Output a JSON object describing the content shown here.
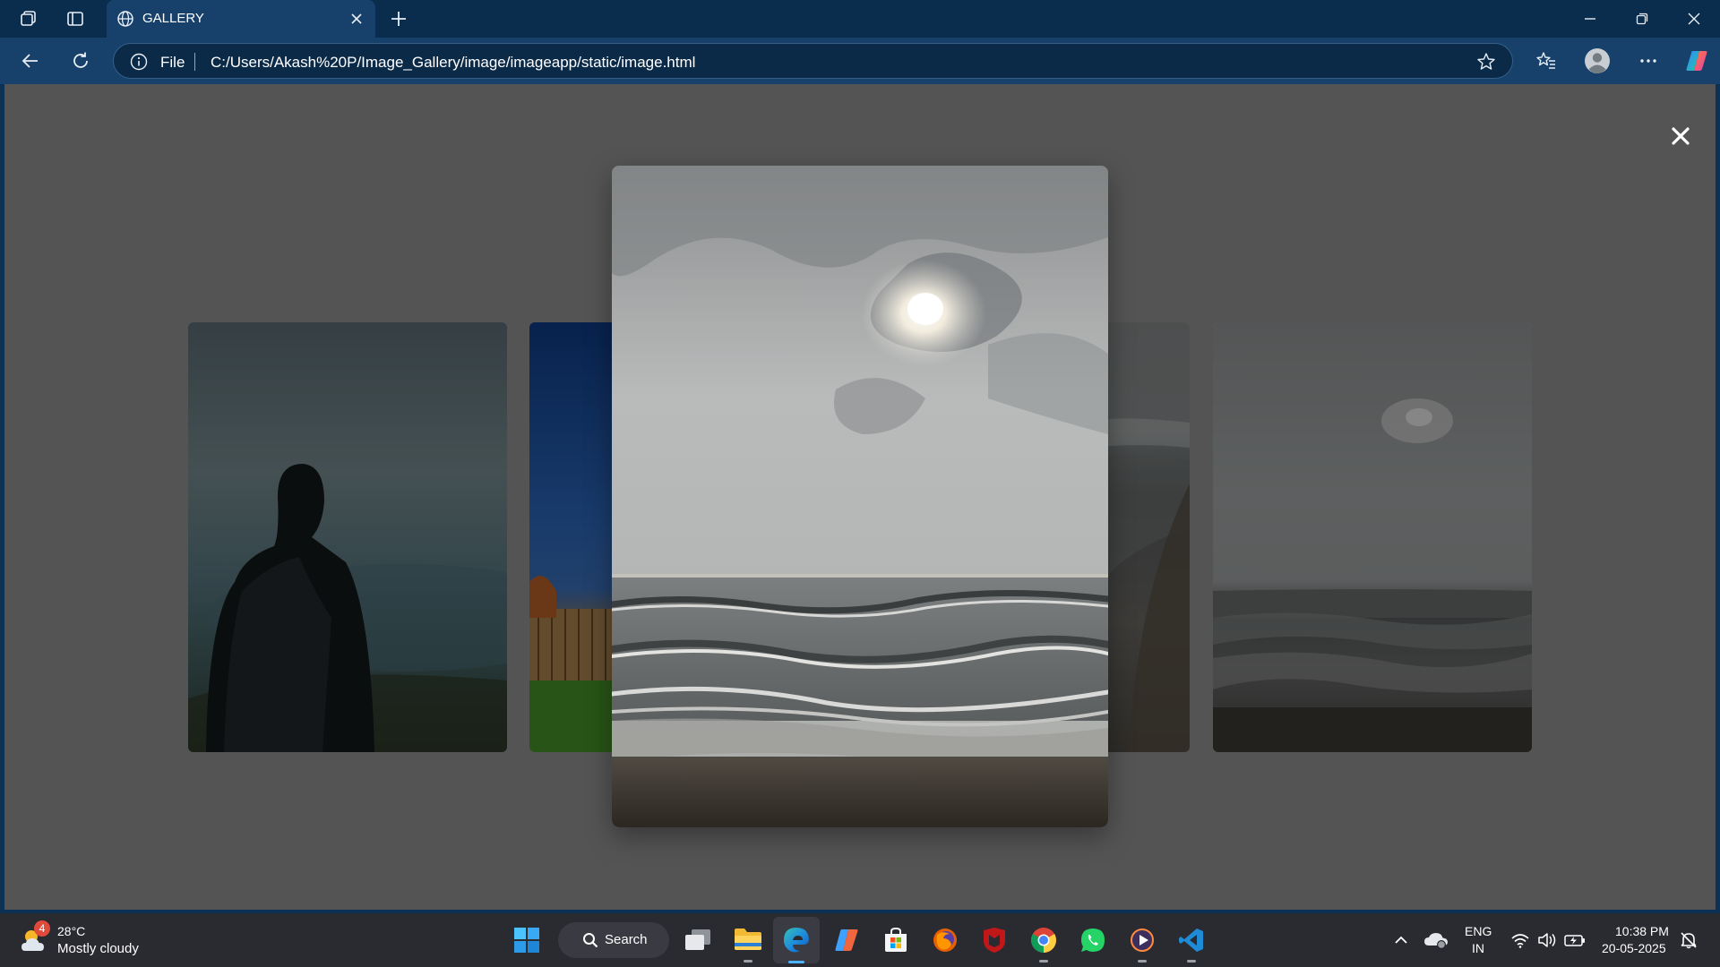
{
  "browser": {
    "tab": {
      "title": "GALLERY"
    },
    "address": {
      "scheme_label": "File",
      "url": "C:/Users/Akash%20P/Image_Gallery/image/imageapp/static/image.html"
    },
    "theme_colors": {
      "frame": "#0a2c4d",
      "toolbar": "#17416a",
      "accent": "#4ab3ff"
    },
    "icons": [
      "workspaces-icon",
      "tab-actions-icon",
      "globe-icon",
      "close-tab-icon",
      "new-tab-icon",
      "back-icon",
      "refresh-icon",
      "info-icon",
      "star-icon",
      "favorites-icon",
      "profile-icon",
      "more-icon",
      "copilot-icon",
      "minimize-icon",
      "restore-icon",
      "close-window-icon"
    ]
  },
  "gallery": {
    "close_icon": "close-icon",
    "photos": [
      "person-silhouette-photo",
      "blue-sky-field-photo",
      "beach-sunlight-clouds-photo",
      "beach-waves-photo",
      "dark-ocean-photo"
    ],
    "backdrop_color": "#545454"
  },
  "taskbar": {
    "weather": {
      "temperature": "28°C",
      "condition": "Mostly cloudy",
      "badge": "4"
    },
    "search_label": "Search",
    "apps": [
      "start-icon",
      "task-view-icon",
      "file-explorer-icon",
      "edge-icon",
      "copilot-app-icon",
      "store-icon",
      "firefox-icon",
      "mcafee-icon",
      "chrome-icon",
      "whatsapp-icon",
      "media-player-icon",
      "vscode-icon"
    ],
    "tray": {
      "language": "ENG",
      "region": "IN",
      "time": "10:38 PM",
      "date": "20-05-2025"
    }
  }
}
